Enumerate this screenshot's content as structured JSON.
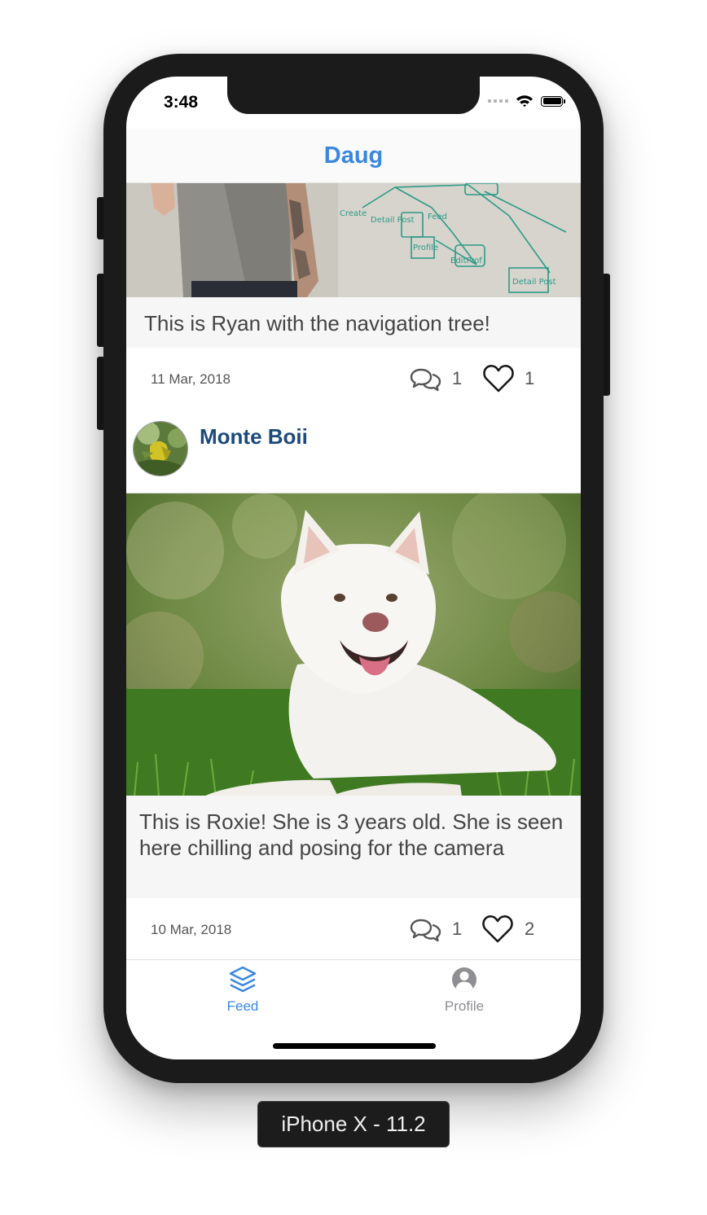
{
  "status_bar": {
    "time": "3:48"
  },
  "nav": {
    "title": "Daug"
  },
  "posts": [
    {
      "caption": "This is Ryan with the navigation tree!",
      "date": "11 Mar, 2018",
      "comments": "1",
      "likes": "1",
      "whiteboard_words": [
        "Create",
        "Detail Post",
        "Feed",
        "Profile",
        "EditProf",
        "Detail Post"
      ]
    },
    {
      "author": "Monte Boii",
      "caption": " This is Roxie! She is 3 years old. She is seen here chilling and posing for the camera",
      "date": "10 Mar, 2018",
      "comments": "1",
      "likes": "2"
    }
  ],
  "tabs": [
    {
      "label": "Feed",
      "icon": "layers-icon",
      "active": true,
      "color": "#3a87e0"
    },
    {
      "label": "Profile",
      "icon": "user-circle-icon",
      "active": false,
      "color": "#8e8e93"
    }
  ],
  "device_label": "iPhone X - 11.2",
  "colors": {
    "accent": "#3a87e0",
    "author": "#1b4a7d"
  }
}
